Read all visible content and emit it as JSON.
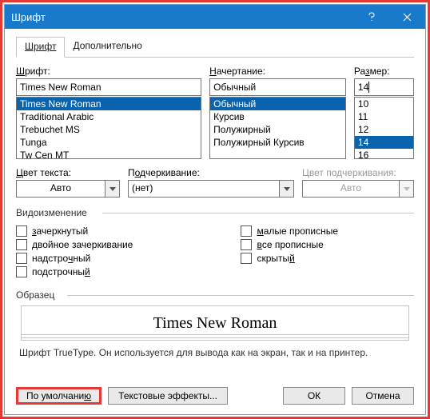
{
  "window": {
    "title": "Шрифт"
  },
  "tabs": {
    "active": "Шрифт",
    "other": "Дополнительно"
  },
  "font": {
    "label": "Шрифт:",
    "value": "Times New Roman",
    "items": [
      "Times New Roman",
      "Traditional Arabic",
      "Trebuchet MS",
      "Tunga",
      "Tw Cen MT"
    ],
    "selected": "Times New Roman"
  },
  "style": {
    "label_pre": "Н",
    "label_rest": "ачертание:",
    "value": "Обычный",
    "items": [
      "Обычный",
      "Курсив",
      "Полужирный",
      "Полужирный Курсив"
    ],
    "selected": "Обычный"
  },
  "size": {
    "label_pre": "Ра",
    "label_hot": "з",
    "label_rest": "мер:",
    "value": "14",
    "items": [
      "10",
      "11",
      "12",
      "14",
      "16"
    ],
    "selected": "14"
  },
  "color_text": {
    "label": "Цвет текста:",
    "value": "Авто"
  },
  "underline": {
    "label_pre": "П",
    "label_hot": "о",
    "label_rest": "дчеркивание:",
    "value": "(нет)"
  },
  "underline_color": {
    "label": "Цвет подчеркивания:",
    "value": "Авто"
  },
  "effects": {
    "legend": "Видоизменение",
    "left": [
      {
        "pre": "",
        "hot": "з",
        "rest": "ачеркнутый"
      },
      {
        "pre": "",
        "hot": "д",
        "rest": "войное зачеркивание"
      },
      {
        "pre": "надстро",
        "hot": "ч",
        "rest": "ный"
      },
      {
        "pre": "подстрочны",
        "hot": "й",
        "rest": ""
      }
    ],
    "right": [
      {
        "pre": "",
        "hot": "м",
        "rest": "алые прописные"
      },
      {
        "pre": "",
        "hot": "в",
        "rest": "се прописные"
      },
      {
        "pre": "скрыты",
        "hot": "й",
        "rest": ""
      }
    ]
  },
  "sample": {
    "legend": "Образец",
    "text": "Times New Roman"
  },
  "hint": "Шрифт TrueType. Он используется для вывода как на экран, так и на принтер.",
  "buttons": {
    "default": "По умолчанию",
    "default_hot": "ю",
    "text_effects": "Текстовые эффекты...",
    "ok": "ОК",
    "cancel": "Отмена"
  }
}
